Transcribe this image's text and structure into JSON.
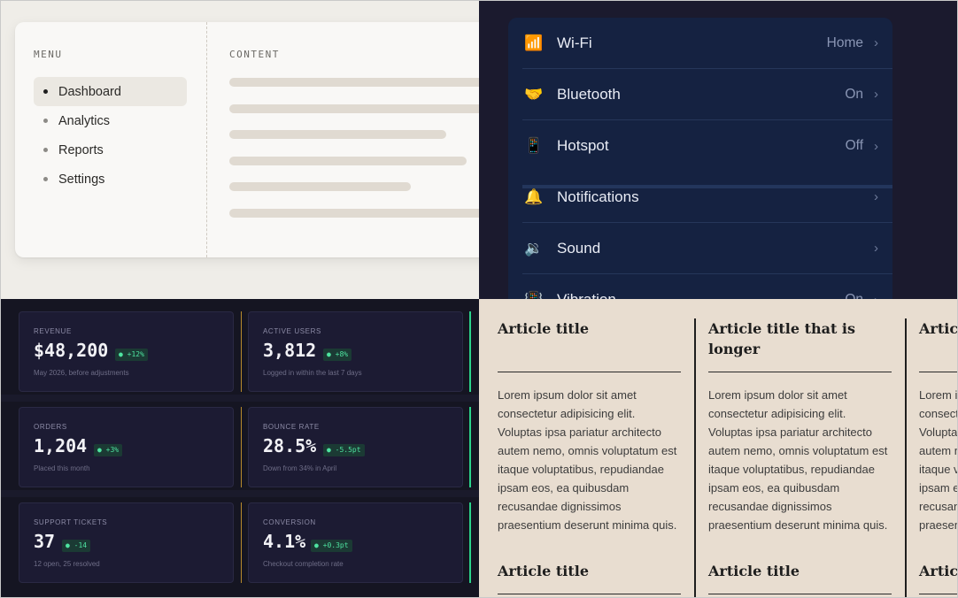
{
  "menu_panel": {
    "menu_heading": "MENU",
    "content_heading": "CONTENT",
    "items": [
      {
        "label": "Dashboard",
        "active": true
      },
      {
        "label": "Analytics",
        "active": false
      },
      {
        "label": "Reports",
        "active": false
      },
      {
        "label": "Settings",
        "active": false
      }
    ]
  },
  "settings_panel": {
    "rows": [
      {
        "icon": "wifi-icon",
        "glyph": "📶",
        "label": "Wi-Fi",
        "value": "Home"
      },
      {
        "icon": "bluetooth-icon",
        "glyph": "🤝",
        "label": "Bluetooth",
        "value": "On"
      },
      {
        "icon": "hotspot-icon",
        "glyph": "📱",
        "label": "Hotspot",
        "value": "Off"
      },
      {
        "icon": "bell-icon",
        "glyph": "🔔",
        "label": "Notifications",
        "value": ""
      },
      {
        "icon": "speaker-icon",
        "glyph": "🔉",
        "label": "Sound",
        "value": ""
      },
      {
        "icon": "vibration-icon",
        "glyph": "📳",
        "label": "Vibration",
        "value": "On"
      }
    ]
  },
  "stats": [
    {
      "label": "REVENUE",
      "value": "$48,200",
      "delta": "+12%",
      "desc": "May 2026, before adjustments"
    },
    {
      "label": "ACTIVE USERS",
      "value": "3,812",
      "delta": "+8%",
      "desc": "Logged in within the last 7 days"
    },
    {
      "label": "ORDERS",
      "value": "1,204",
      "delta": "+3%",
      "desc": "Placed this month"
    },
    {
      "label": "BOUNCE RATE",
      "value": "28.5%",
      "delta": "-5.5pt",
      "desc": "Down from 34% in April"
    },
    {
      "label": "SUPPORT TICKETS",
      "value": "37",
      "delta": "-14",
      "desc": "12 open, 25 resolved"
    },
    {
      "label": "CONVERSION",
      "value": "4.1%",
      "delta": "+0.3pt",
      "desc": "Checkout completion rate"
    }
  ],
  "articles": {
    "columns": [
      {
        "title": "Article title",
        "next_title": "Article title"
      },
      {
        "title": "Article title that is longer",
        "next_title": "Article title"
      },
      {
        "title": "Article title",
        "next_title": "Article title"
      }
    ],
    "body": "Lorem ipsum dolor sit amet consectetur adipisicing elit. Voluptas ipsa pariatur architecto autem nemo, omnis voluptatum est itaque voluptatibus, repudiandae ipsam eos, ea quibusdam recusandae dignissimos praesentium deserunt minima quis."
  },
  "colors": {
    "settings_bg": "#152241",
    "stat_card_bg": "#1c1b33",
    "delta_green": "#4ee3a0",
    "article_bg": "#e8ddd0"
  }
}
